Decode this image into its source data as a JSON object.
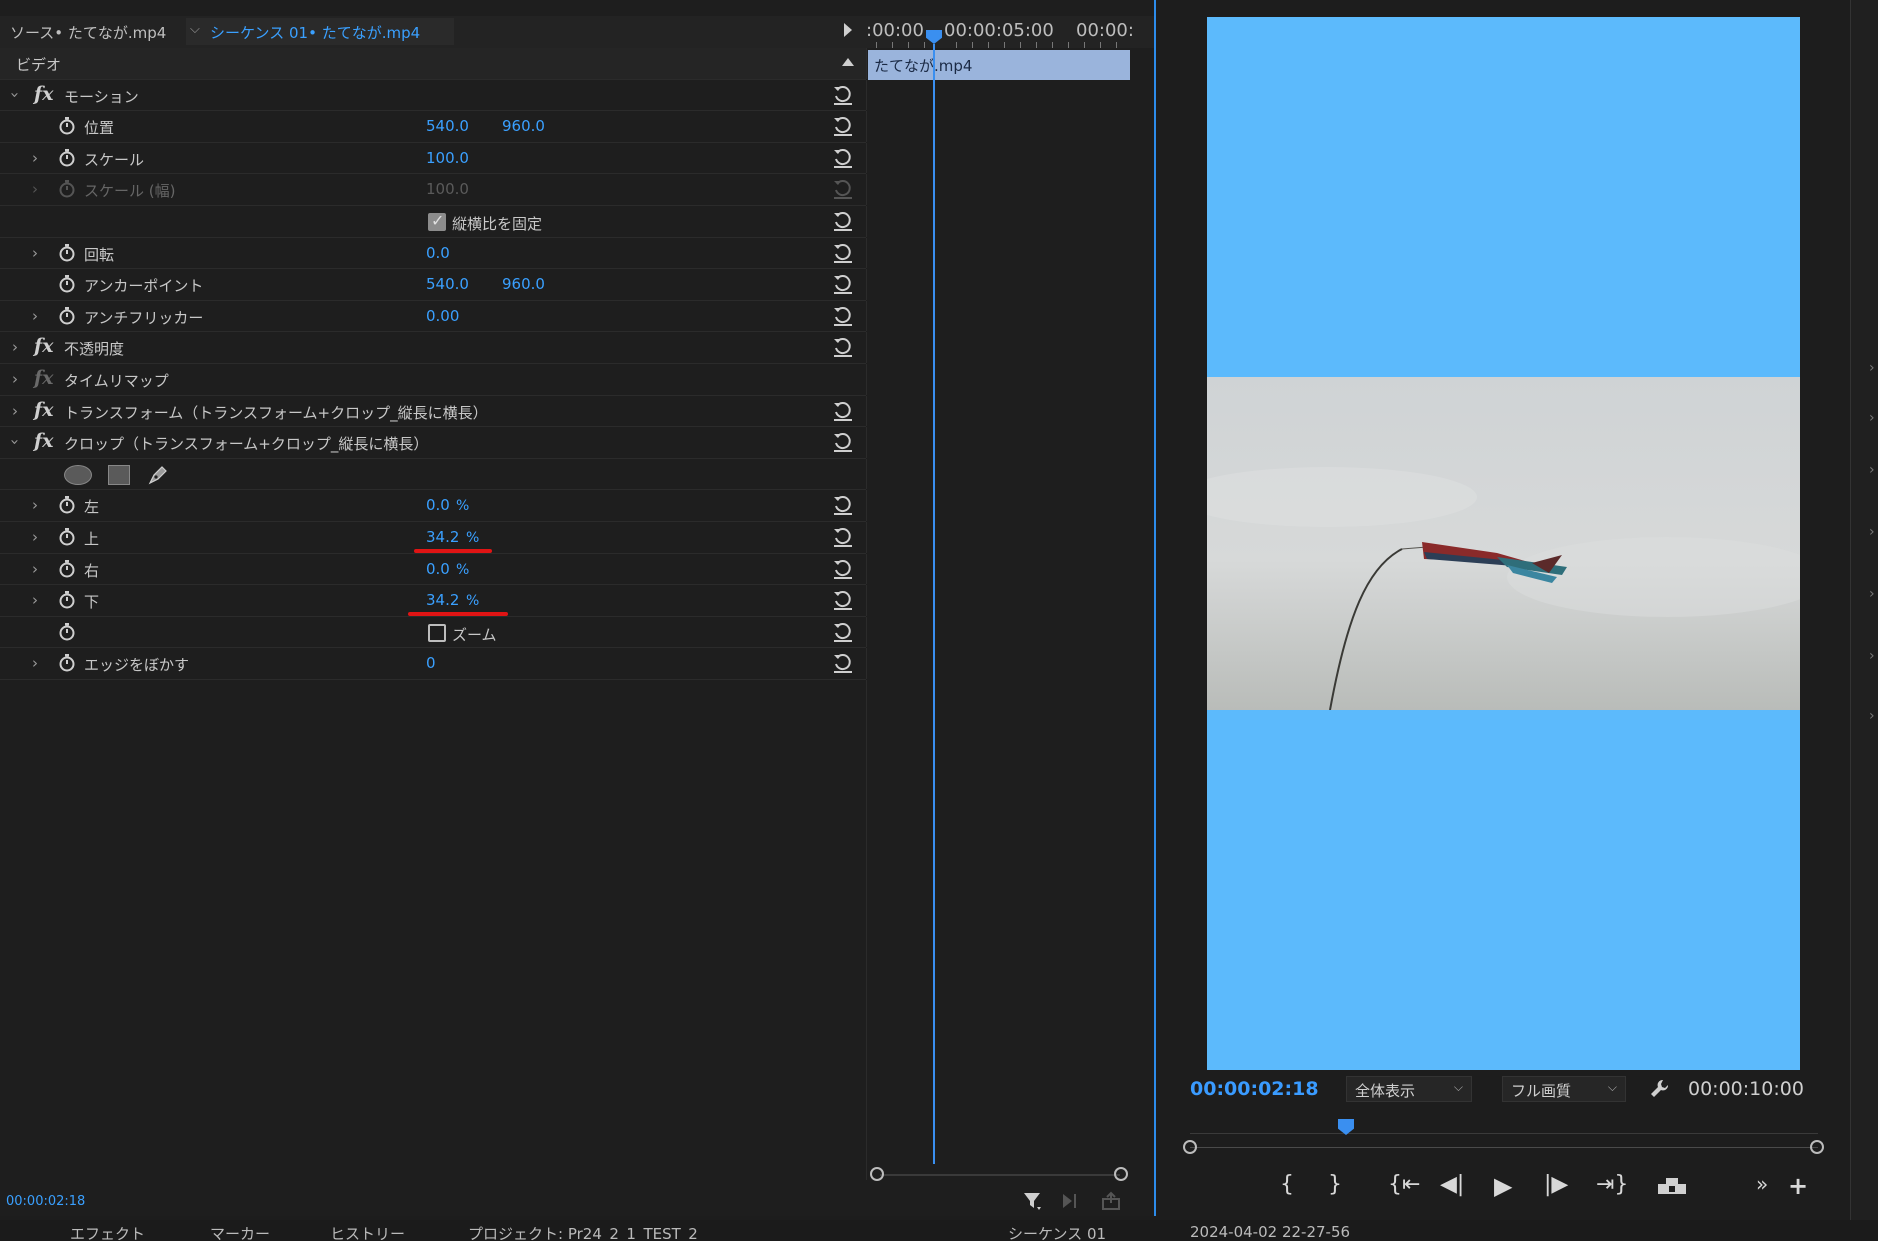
{
  "effect_controls": {
    "source_tab": "ソース• たてなが.mp4",
    "sequence_tab": "シーケンス 01• たてなが.mp4",
    "ruler": {
      "tc1": ":00:00",
      "tc2": "00:00:05:00",
      "tc3": "00:00:"
    },
    "clip_name": "たてなが.mp4",
    "video_header": "ビデオ",
    "motion": {
      "name": "モーション",
      "position": {
        "label": "位置",
        "x": "540.0",
        "y": "960.0"
      },
      "scale": {
        "label": "スケール",
        "value": "100.0"
      },
      "scale_width": {
        "label": "スケール (幅)",
        "value": "100.0"
      },
      "uniform_scale": {
        "label": "縦横比を固定",
        "checked": true
      },
      "rotation": {
        "label": "回転",
        "value": "0.0"
      },
      "anchor": {
        "label": "アンカーポイント",
        "x": "540.0",
        "y": "960.0"
      },
      "anti_flicker": {
        "label": "アンチフリッカー",
        "value": "0.00"
      }
    },
    "opacity": "不透明度",
    "time_remap": "タイムリマップ",
    "transform": "トランスフォーム（トランスフォーム+クロップ_縦長に横長）",
    "crop": {
      "name": "クロップ（トランスフォーム+クロップ_縦長に横長）",
      "left": {
        "label": "左",
        "value": "0.0",
        "unit": "%"
      },
      "top": {
        "label": "上",
        "value": "34.2",
        "unit": "%"
      },
      "right": {
        "label": "右",
        "value": "0.0",
        "unit": "%"
      },
      "bottom": {
        "label": "下",
        "value": "34.2",
        "unit": "%"
      },
      "zoom": {
        "label": "ズーム",
        "checked": false
      },
      "feather": {
        "label": "エッジをぼかす",
        "value": "0"
      }
    },
    "current_time": "00:00:02:18"
  },
  "program_monitor": {
    "current_time": "00:00:02:18",
    "fit": "全体表示",
    "quality": "フル画質",
    "duration": "00:00:10:00",
    "frame_colors": {
      "background": "#5cbafc"
    }
  },
  "bottom_tabs": {
    "effects": "エフェクト",
    "markers": "マーカー",
    "history": "ヒストリー",
    "project": "プロジェクト: Pr24_2_1_TEST_2",
    "sequence": "シーケンス 01",
    "date": "2024-04-02 22-27-56"
  }
}
